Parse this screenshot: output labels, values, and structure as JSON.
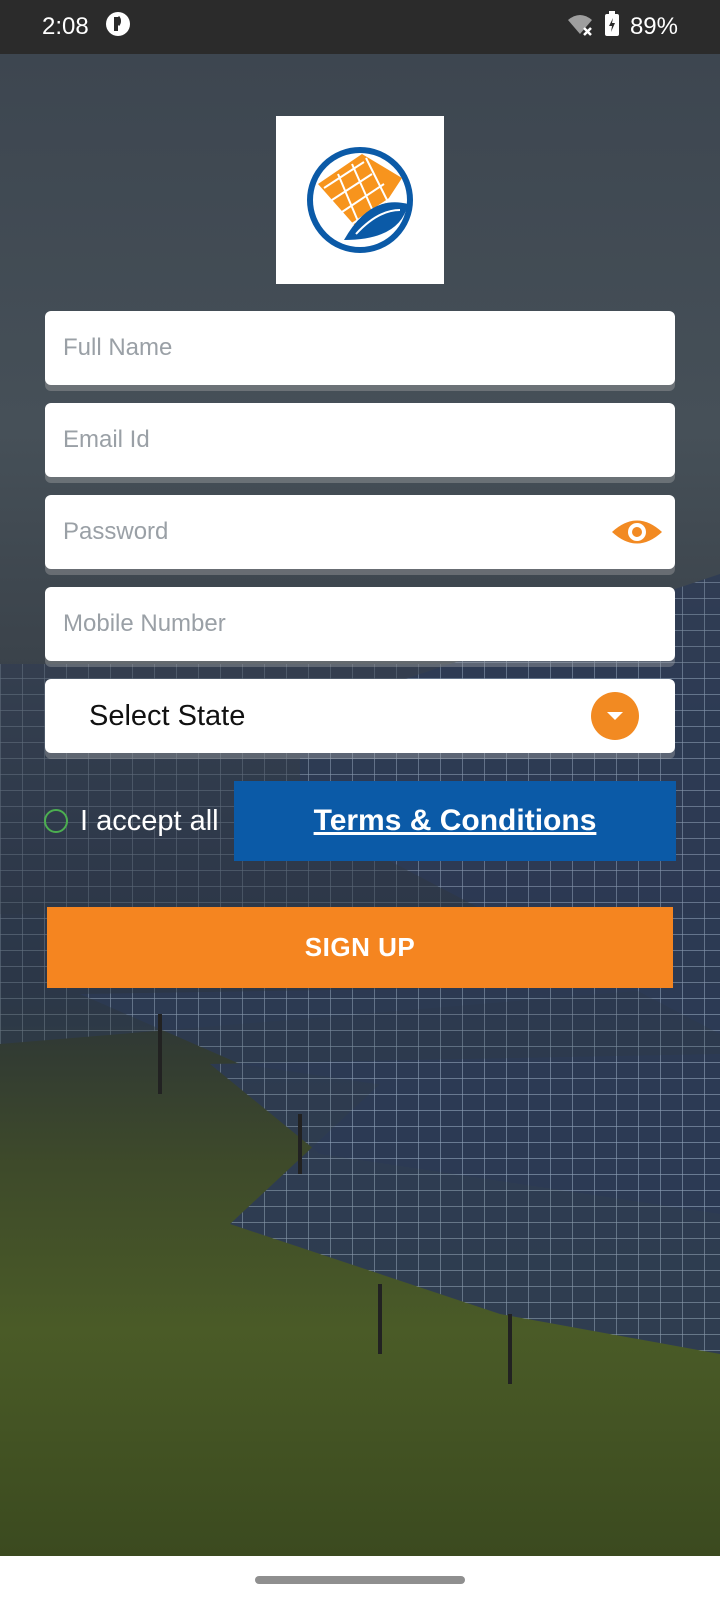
{
  "status_bar": {
    "time": "2:08",
    "battery": "89%",
    "icons": [
      "sync-badge-icon",
      "wifi-off-icon",
      "battery-charging-icon"
    ]
  },
  "form": {
    "full_name": {
      "placeholder": "Full Name",
      "value": ""
    },
    "email": {
      "placeholder": "Email Id",
      "value": ""
    },
    "password": {
      "placeholder": "Password",
      "value": ""
    },
    "mobile": {
      "placeholder": "Mobile Number",
      "value": ""
    },
    "state_select": {
      "value": "Select State"
    },
    "accept_label": "I accept all",
    "terms_label": "Terms & Conditions",
    "signup_label": "SIGN UP"
  },
  "colors": {
    "accent_orange": "#f58520",
    "terms_blue": "#0b5aa7",
    "radio_green": "#4caf50"
  }
}
